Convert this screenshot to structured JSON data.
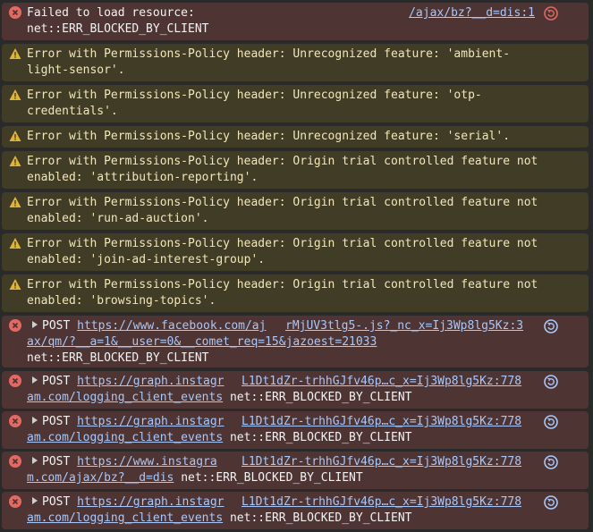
{
  "colors": {
    "error_bg": "#4e3534",
    "warning_bg": "#413c26",
    "link": "#a8c7fa",
    "error_icon": "#e46962",
    "warning_icon": "#e0b434"
  },
  "messages": [
    {
      "type": "error",
      "line1": "Failed to load resource:",
      "source": "/ajax/bz?__d=dis:1",
      "line2": "net::ERR_BLOCKED_BY_CLIENT"
    },
    {
      "type": "warning",
      "line1": "Error with Permissions-Policy header: Unrecognized feature: 'ambient-",
      "line2": "light-sensor'."
    },
    {
      "type": "warning",
      "line1": "Error with Permissions-Policy header: Unrecognized feature: 'otp-",
      "line2": "credentials'."
    },
    {
      "type": "warning",
      "line1": "Error with Permissions-Policy header: Unrecognized feature: 'serial'."
    },
    {
      "type": "warning",
      "line1": "Error with Permissions-Policy header: Origin trial controlled feature not",
      "line2": "enabled: 'attribution-reporting'."
    },
    {
      "type": "warning",
      "line1": "Error with Permissions-Policy header: Origin trial controlled feature not",
      "line2": "enabled: 'run-ad-auction'."
    },
    {
      "type": "warning",
      "line1": "Error with Permissions-Policy header: Origin trial controlled feature not",
      "line2": "enabled: 'join-ad-interest-group'."
    },
    {
      "type": "warning",
      "line1": "Error with Permissions-Policy header: Origin trial controlled feature not",
      "line2": "enabled: 'browsing-topics'."
    },
    {
      "type": "error",
      "method": "POST",
      "url_part1": "https://www.facebook.com/aj",
      "source": "rMjUV3tlg5-.js?_nc_x=Ij3Wp8lg5Kz:3",
      "url_part2": "ax/qm/?__a=1&__user=0&__comet_req=15&jazoest=21033",
      "line3": "net::ERR_BLOCKED_BY_CLIENT"
    },
    {
      "type": "error",
      "method": "POST",
      "url_part1": "https://graph.instagr",
      "source": "L1Dt1dZr-trhhGJfv46p…c_x=Ij3Wp8lg5Kz:778",
      "url_part2": "am.com/logging_client_events",
      "status": "net::ERR_BLOCKED_BY_CLIENT"
    },
    {
      "type": "error",
      "method": "POST",
      "url_part1": "https://graph.instagr",
      "source": "L1Dt1dZr-trhhGJfv46p…c_x=Ij3Wp8lg5Kz:778",
      "url_part2": "am.com/logging_client_events",
      "status": "net::ERR_BLOCKED_BY_CLIENT"
    },
    {
      "type": "error",
      "method": "POST",
      "url_part1": "https://www.instagra",
      "source": "L1Dt1dZr-trhhGJfv46p…c_x=Ij3Wp8lg5Kz:778",
      "url_part2": "m.com/ajax/bz?__d=dis",
      "status": "net::ERR_BLOCKED_BY_CLIENT"
    },
    {
      "type": "error",
      "method": "POST",
      "url_part1": "https://graph.instagr",
      "source": "L1Dt1dZr-trhhGJfv46p…c_x=Ij3Wp8lg5Kz:778",
      "url_part2": "am.com/logging_client_events",
      "status": "net::ERR_BLOCKED_BY_CLIENT"
    }
  ]
}
